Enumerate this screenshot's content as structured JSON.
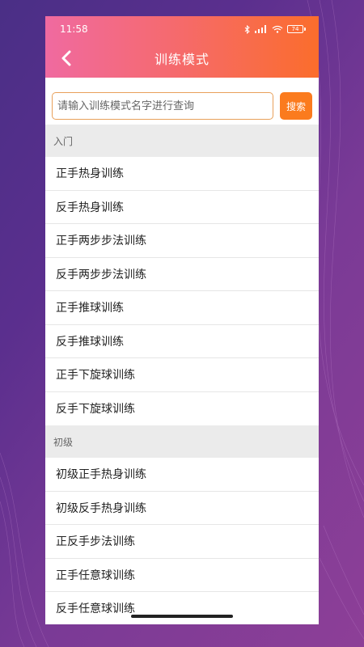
{
  "status_bar": {
    "time": "11:58",
    "battery": "74"
  },
  "header": {
    "title": "训练模式"
  },
  "search": {
    "placeholder": "请输入训练模式名字进行查询",
    "button_label": "搜索"
  },
  "sections": [
    {
      "title": "入门",
      "items": [
        "正手热身训练",
        "反手热身训练",
        "正手两步步法训练",
        "反手两步步法训练",
        "正手推球训练",
        "反手推球训练",
        "正手下旋球训练",
        "反手下旋球训练"
      ]
    },
    {
      "title": "初级",
      "items": [
        "初级正手热身训练",
        "初级反手热身训练",
        "正反手步法训练",
        "正手任意球训练",
        "反手任意球训练"
      ]
    }
  ]
}
